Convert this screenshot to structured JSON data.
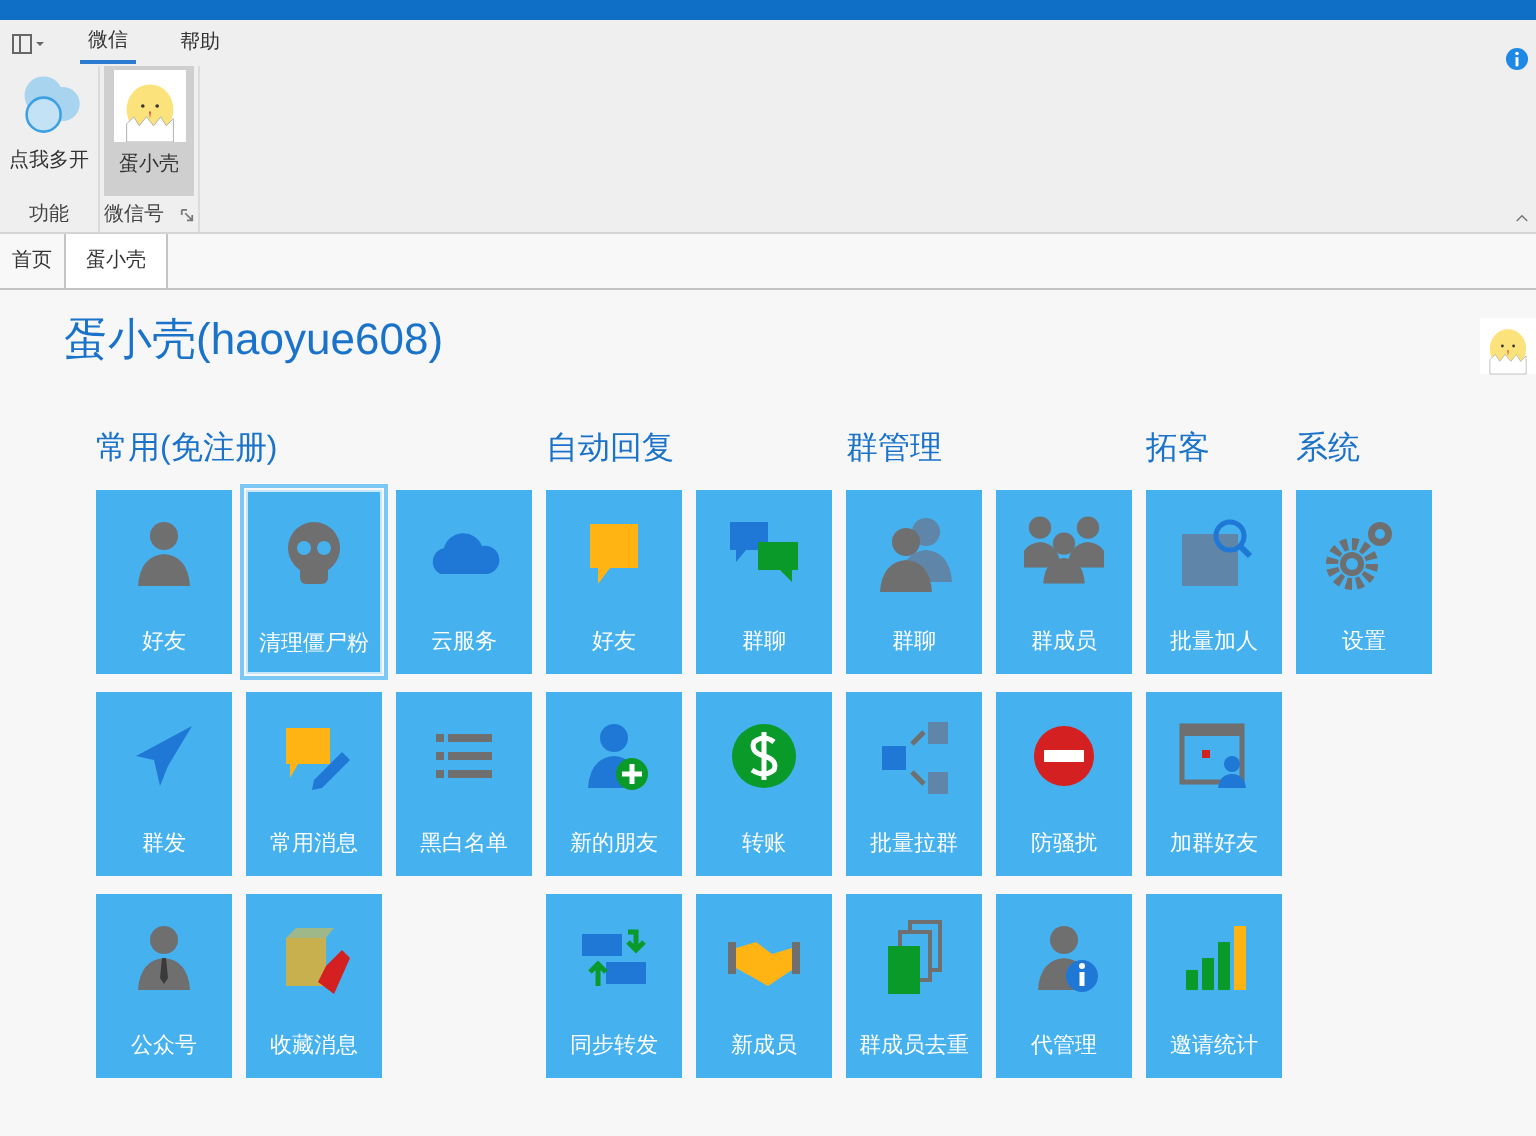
{
  "menu_tabs": [
    {
      "label": "微信",
      "selected": true
    },
    {
      "label": "帮助",
      "selected": false
    }
  ],
  "ribbon_groups": [
    {
      "caption": "功能",
      "items": [
        {
          "label": "点我多开",
          "selected": false
        }
      ],
      "launcher": false
    },
    {
      "caption": "微信号",
      "items": [
        {
          "label": "蛋小壳",
          "selected": true
        }
      ],
      "launcher": true
    }
  ],
  "doc_tabs": [
    {
      "label": "首页",
      "selected": false
    },
    {
      "label": "蛋小壳",
      "selected": true
    }
  ],
  "page_title": "蛋小壳(haoyue608)",
  "groups": [
    {
      "title": "常用(免注册)",
      "columns": [
        [
          {
            "label": "好友",
            "selected": false
          },
          {
            "label": "群发",
            "selected": false
          },
          {
            "label": "公众号",
            "selected": false
          }
        ],
        [
          {
            "label": "清理僵尸粉",
            "selected": true
          },
          {
            "label": "常用消息",
            "selected": false
          },
          {
            "label": "收藏消息",
            "selected": false
          }
        ],
        [
          {
            "label": "云服务",
            "selected": false
          },
          {
            "label": "黑白名单",
            "selected": false
          }
        ]
      ]
    },
    {
      "title": "自动回复",
      "columns": [
        [
          {
            "label": "好友",
            "selected": false
          },
          {
            "label": "新的朋友",
            "selected": false
          },
          {
            "label": "同步转发",
            "selected": false
          }
        ],
        [
          {
            "label": "群聊",
            "selected": false
          },
          {
            "label": "转账",
            "selected": false
          },
          {
            "label": "新成员",
            "selected": false
          }
        ]
      ]
    },
    {
      "title": "群管理",
      "columns": [
        [
          {
            "label": "群聊",
            "selected": false
          },
          {
            "label": "批量拉群",
            "selected": false
          },
          {
            "label": "群成员去重",
            "selected": false
          }
        ],
        [
          {
            "label": "群成员",
            "selected": false
          },
          {
            "label": "防骚扰",
            "selected": false
          },
          {
            "label": "代管理",
            "selected": false
          }
        ]
      ]
    },
    {
      "title": "拓客",
      "columns": [
        [
          {
            "label": "批量加人",
            "selected": false
          },
          {
            "label": "加群好友",
            "selected": false
          },
          {
            "label": "邀请统计",
            "selected": false
          }
        ]
      ]
    },
    {
      "title": "系统",
      "columns": [
        [
          {
            "label": "设置",
            "selected": false
          }
        ]
      ]
    }
  ]
}
